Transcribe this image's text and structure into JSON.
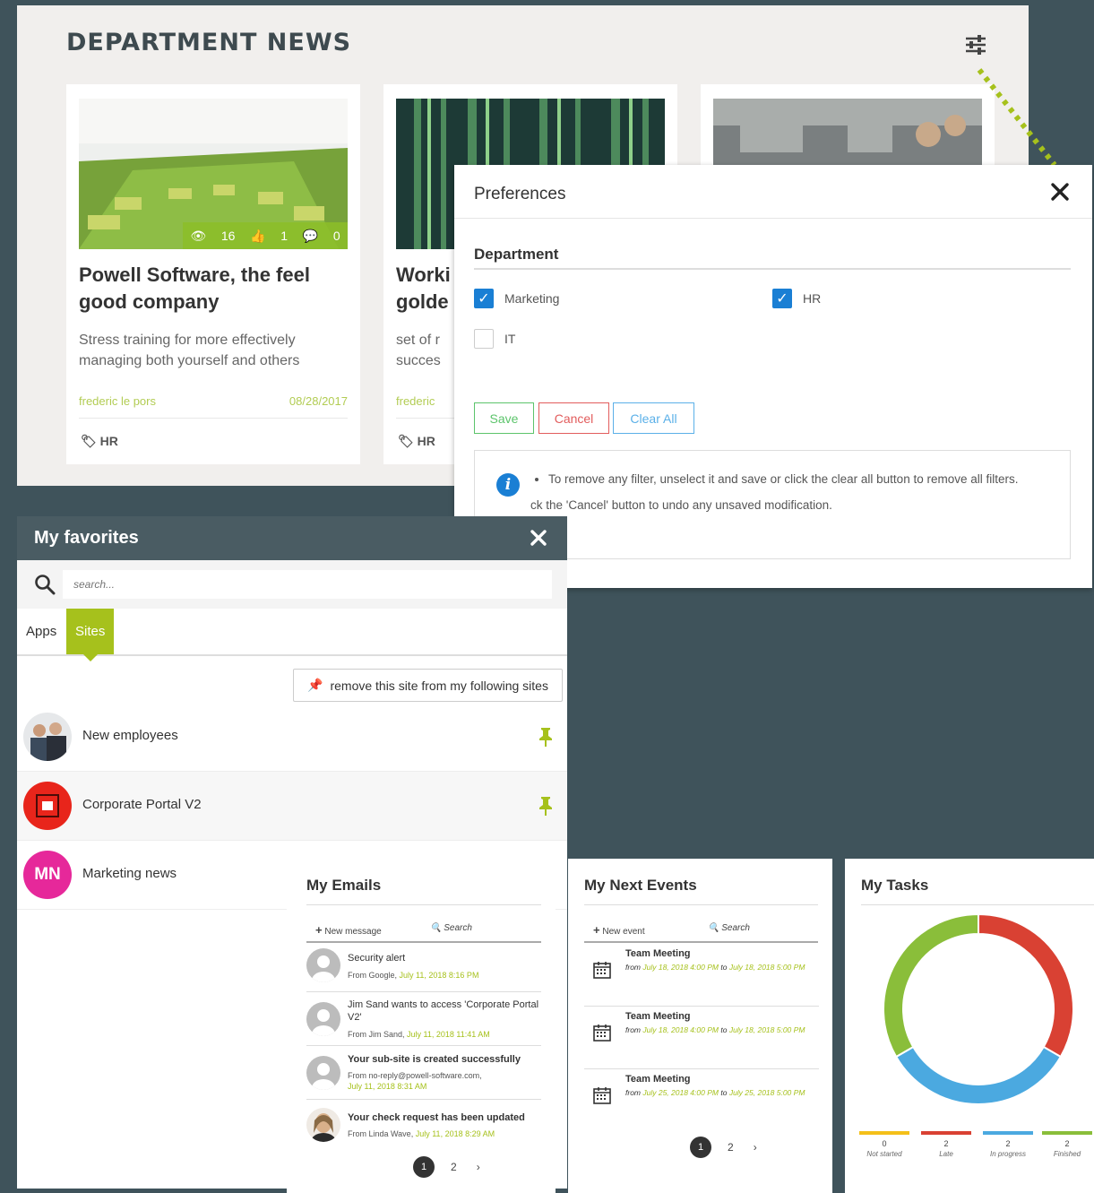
{
  "news": {
    "title": "DEPARTMENT NEWS",
    "cards": [
      {
        "title": "Powell Software, the feel good company",
        "desc": "Stress training for more effectively managing both yourself and others",
        "author": "frederic le pors",
        "date": "08/28/2017",
        "tag": "HR",
        "views": "16",
        "likes": "1",
        "comments": "0"
      },
      {
        "title": "Worki golde",
        "desc": "set of r succes",
        "author": "frederic",
        "tag": "HR"
      }
    ]
  },
  "prefs": {
    "title": "Preferences",
    "section": "Department",
    "options": [
      {
        "label": "Marketing",
        "checked": true
      },
      {
        "label": "HR",
        "checked": true
      },
      {
        "label": "IT",
        "checked": false
      }
    ],
    "buttons": {
      "save": "Save",
      "cancel": "Cancel",
      "clear": "Clear All"
    },
    "info": [
      "To remove any filter, unselect it and save or click the clear all button to remove all filters.",
      "ck the 'Cancel' button to undo any unsaved modification."
    ]
  },
  "favorites": {
    "title": "My favorites",
    "search_placeholder": "search...",
    "tabs": [
      "Apps",
      "Sites"
    ],
    "active_tab": "Sites",
    "remove_label": "remove this site from my following sites",
    "sites": [
      {
        "name": "New employees"
      },
      {
        "name": "Corporate Portal V2"
      },
      {
        "name": "Marketing news",
        "initials": "MN"
      }
    ]
  },
  "emails": {
    "title": "My Emails",
    "new_label": "New message",
    "search_label": "Search",
    "items": [
      {
        "subject": "Security alert",
        "from": "From Google,",
        "date": "July 11, 2018 8:16 PM",
        "bold": false
      },
      {
        "subject": "Jim Sand wants to access 'Corporate Portal V2'",
        "from": "From Jim Sand,",
        "date": "July 11, 2018 11:41 AM",
        "bold": false
      },
      {
        "subject": "Your sub-site is created successfully",
        "from": "From no-reply@powell-software.com,",
        "date": "July 11, 2018 8:31 AM",
        "bold": true
      },
      {
        "subject": "Your check request has been updated",
        "from": "From Linda Wave,",
        "date": "July 11, 2018 8:29 AM",
        "bold": true
      }
    ],
    "pages": [
      "1",
      "2",
      "›"
    ]
  },
  "events": {
    "title": "My Next Events",
    "new_label": "New event",
    "search_label": "Search",
    "items": [
      {
        "title": "Team Meeting",
        "from": "July 18, 2018 4:00 PM",
        "to": "July 18, 2018 5:00 PM"
      },
      {
        "title": "Team Meeting",
        "from": "July 18, 2018 4:00 PM",
        "to": "July 18, 2018 5:00 PM"
      },
      {
        "title": "Team Meeting",
        "from": "July 25, 2018 4:00 PM",
        "to": "July 25, 2018 5:00 PM"
      }
    ],
    "from_word": "from",
    "to_word": "to",
    "pages": [
      "1",
      "2",
      "›"
    ]
  },
  "tasks": {
    "title": "My Tasks",
    "colors": {
      "not_started": "#f4c019",
      "late": "#d94133",
      "in_progress": "#4ba9e0",
      "finished": "#8abe3a"
    },
    "chart_data": {
      "type": "pie",
      "categories": [
        "Not started",
        "Late",
        "In progress",
        "Finished"
      ],
      "values": [
        0,
        2,
        2,
        2
      ]
    }
  }
}
